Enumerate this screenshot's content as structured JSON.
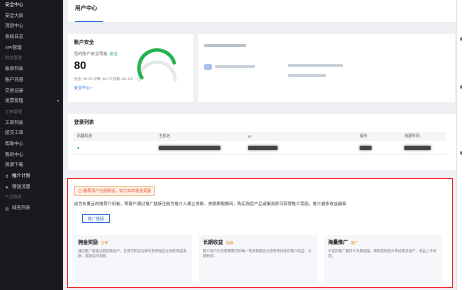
{
  "sidebar": {
    "items": [
      {
        "label": "安全中心",
        "kind": "item",
        "active": true
      },
      {
        "label": "安全大屏",
        "kind": "item"
      },
      {
        "label": "消息中心",
        "kind": "item"
      },
      {
        "label": "系统日志",
        "kind": "item"
      },
      {
        "label": "API管理",
        "kind": "item"
      },
      {
        "label": "财务管理",
        "kind": "group"
      },
      {
        "label": "账单列表",
        "kind": "item"
      },
      {
        "label": "账户充值",
        "kind": "item"
      },
      {
        "label": "交易记录",
        "kind": "item"
      },
      {
        "label": "发票管理",
        "kind": "item",
        "chevron": "chevron-down-icon"
      },
      {
        "label": "工单管理",
        "kind": "group"
      },
      {
        "label": "工单列表",
        "kind": "item"
      },
      {
        "label": "提交工单",
        "kind": "item"
      },
      {
        "label": "帮助中心",
        "kind": "item"
      },
      {
        "label": "我的中心",
        "kind": "item"
      },
      {
        "label": "资源下载",
        "kind": "item"
      },
      {
        "label": "推介计划",
        "kind": "item",
        "icon": "share-icon",
        "active": true
      },
      {
        "label": "赠送流量",
        "kind": "item",
        "icon": "gift-icon"
      },
      {
        "label": "产品服务",
        "kind": "group"
      },
      {
        "label": "域名列表",
        "kind": "item",
        "icon": "globe-icon"
      }
    ]
  },
  "header": {
    "title": "用户中心"
  },
  "security": {
    "title": "账户安全",
    "label": "您的账户安全等级",
    "tag": "安全",
    "score": "80",
    "detail": "安全: 95-99 中等: 48-79 较弱: 80-100",
    "link": "安全中心 ›",
    "gauge_value": 80
  },
  "login": {
    "title": "登录列表",
    "columns": [
      "机器状态",
      "主机名",
      "IP",
      "省份",
      "创建时间"
    ],
    "rows": [
      {
        "status": "●",
        "host": "▇▇▇▇▇▇▇▇▇▇▇▇▇▇▇▇▇▇▇▇▇",
        "ip": "▇▇▇▇▇▇▇▇▇▇",
        "province": "▇▇▇▇",
        "time": "▇▇▇▇▇▇▇▇▇"
      }
    ]
  },
  "promo": {
    "warning": "⚠ 推荐用户注册即送，实打实的现金奖励",
    "description": "成为东夏云的推荐介绍者，将客户通过推广链接注册为推介人建立关联，关联期限期间，购买指定产品或服务即可获得推介奖励，推介越多收益越高",
    "button": "推广链接",
    "features": [
      {
        "title": "佣金奖励",
        "badge": "分享",
        "text": "通过推广链接注册的新用户，在首次购买后即可获得相应比例的现金奖励，奖励实时到账。"
      },
      {
        "title": "长期收益",
        "badge": "持续",
        "text": "推介用户在关联期限内的每一笔消费都会为您带来持续的推介收益，长期有效。"
      },
      {
        "title": "海量推广",
        "badge": "推广",
        "text": "丰富的推广素材与专属链接，帮助您轻松分享给更多用户，收益上不封顶。"
      }
    ]
  },
  "colors": {
    "accent": "#2f6bdc",
    "alert": "#e22222",
    "success": "#16a34a",
    "sidebar": "#17191d"
  }
}
